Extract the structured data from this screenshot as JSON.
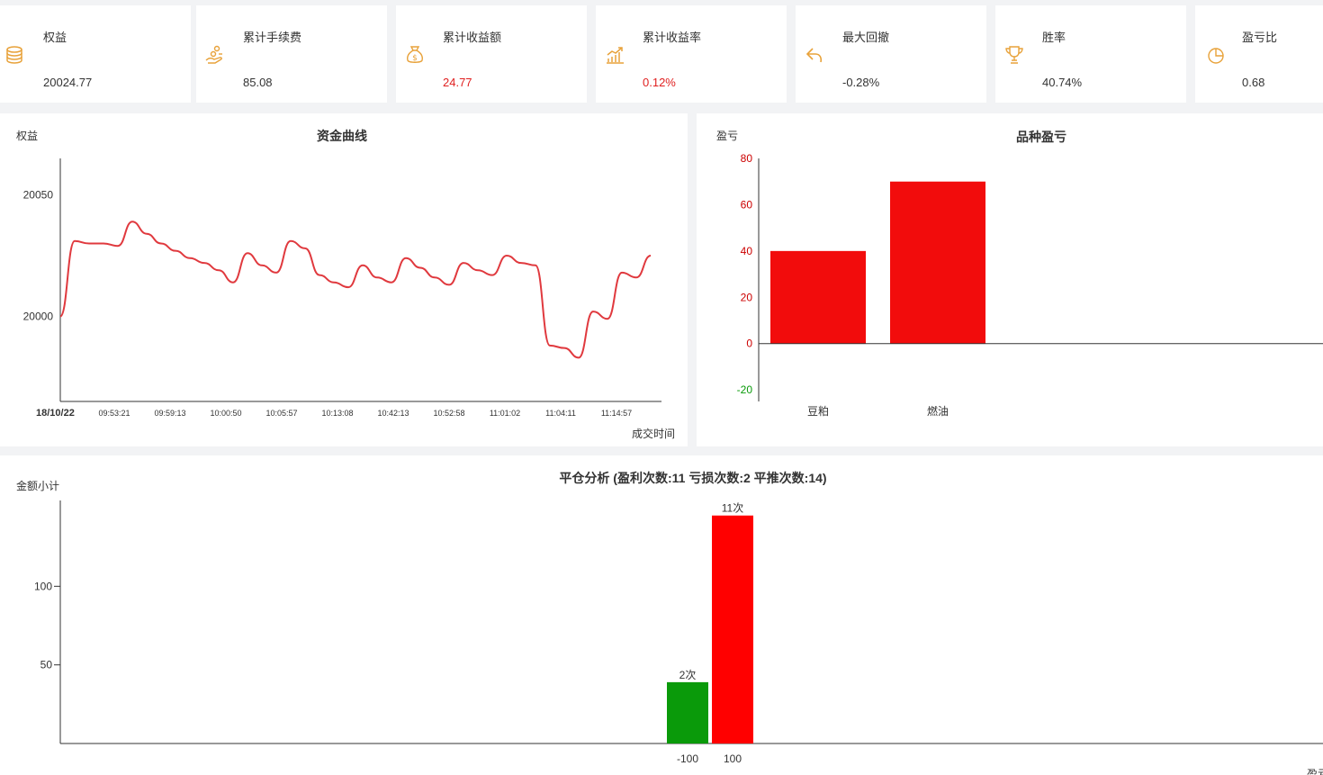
{
  "stats": [
    {
      "label": "权益",
      "value": "20024.77",
      "icon": "coins-icon",
      "value_color": "#333333"
    },
    {
      "label": "累计手续费",
      "value": "85.08",
      "icon": "hand-coins-icon",
      "value_color": "#333333"
    },
    {
      "label": "累计收益额",
      "value": "24.77",
      "icon": "money-bag-icon",
      "value_color": "#e02020"
    },
    {
      "label": "累计收益率",
      "value": "0.12%",
      "icon": "growth-chart-icon",
      "value_color": "#e02020"
    },
    {
      "label": "最大回撤",
      "value": "-0.28%",
      "icon": "undo-arrow-icon",
      "value_color": "#333333"
    },
    {
      "label": "胜率",
      "value": "40.74%",
      "icon": "trophy-icon",
      "value_color": "#333333"
    },
    {
      "label": "盈亏比",
      "value": "0.68",
      "icon": "pie-chart-icon",
      "value_color": "#333333"
    }
  ],
  "accent_color": "#e8a23a",
  "chart_data": [
    {
      "type": "line",
      "title": "资金曲线",
      "ylabel": "权益",
      "xlabel": "成交时间",
      "date_label": "18/10/22",
      "x_ticks": [
        "09:53:21",
        "09:59:13",
        "10:00:50",
        "10:05:57",
        "10:13:08",
        "10:42:13",
        "10:52:58",
        "11:01:02",
        "11:04:11",
        "11:14:57"
      ],
      "y_ticks": [
        20000,
        20050
      ],
      "ylim": [
        19965,
        20065
      ],
      "line_color": "#e0393e",
      "series": [
        {
          "values": [
            20000,
            20031,
            20030,
            20030,
            20029,
            20039,
            20034,
            20030,
            20027,
            20024,
            20022,
            20019,
            20014,
            20026,
            20021,
            20018,
            20031,
            20028,
            20017,
            20014,
            20012,
            20021,
            20016,
            20014,
            20024,
            20020,
            20016,
            20013,
            20022,
            20019,
            20017,
            20025,
            20022,
            20021,
            19988,
            19987,
            19983,
            20002,
            19999,
            20018,
            20016,
            20025
          ]
        }
      ]
    },
    {
      "type": "bar",
      "title": "品种盈亏",
      "ylabel": "盈亏",
      "categories": [
        "豆粕",
        "燃油"
      ],
      "values": [
        40,
        70
      ],
      "ylim": [
        -25,
        80
      ],
      "y_ticks": [
        -20,
        0,
        20,
        40,
        60,
        80
      ],
      "bar_color": "#f20c0c",
      "positive_tick_color": "#cc0000",
      "negative_tick_color": "#0a9a0a"
    },
    {
      "type": "bar",
      "title": "平仓分析 (盈利次数:11 亏损次数:2 平推次数:14)",
      "ylabel": "金额小计",
      "xlabel": "盈亏",
      "categories": [
        "-100",
        "100"
      ],
      "values": [
        39,
        145
      ],
      "data_labels": [
        "2次",
        "11次"
      ],
      "bar_colors": [
        "#0a9a0a",
        "#ff0000"
      ],
      "y_ticks": [
        50,
        100
      ],
      "ylim": [
        0,
        150
      ]
    }
  ]
}
